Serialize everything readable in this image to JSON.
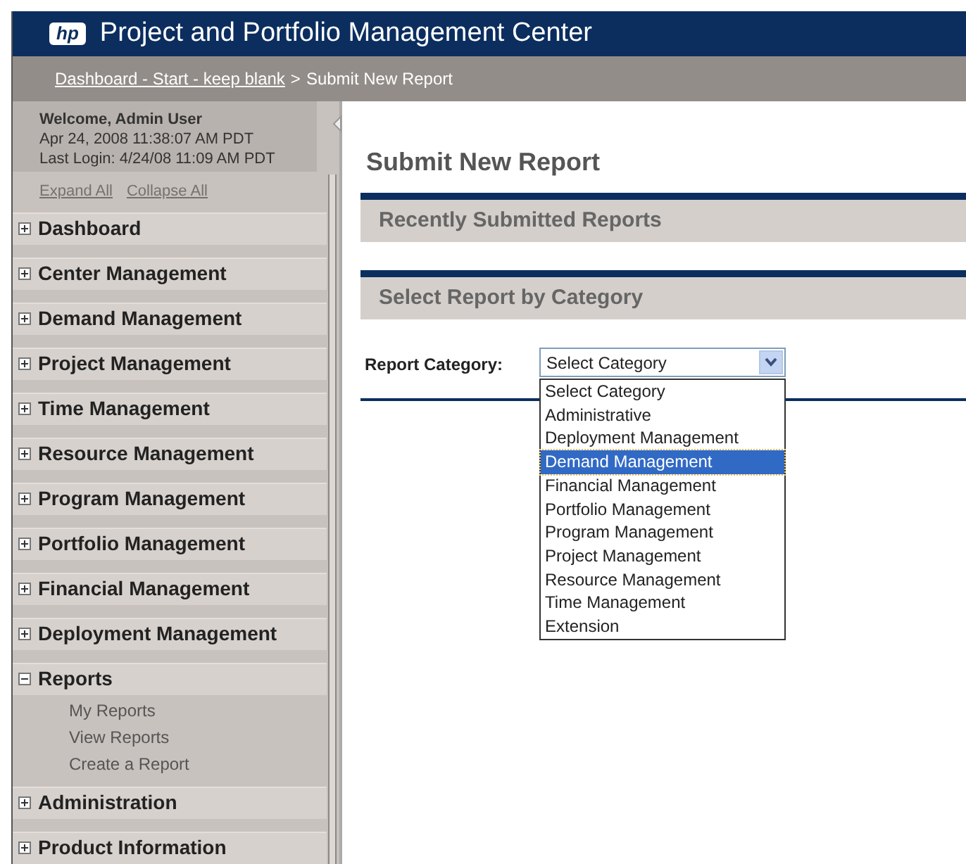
{
  "header": {
    "logo_text": "hp",
    "title": "Project and Portfolio Management Center"
  },
  "breadcrumb": {
    "link": "Dashboard - Start - keep blank",
    "separator": ">",
    "current": "Submit New Report"
  },
  "sidebar": {
    "welcome": "Welcome, Admin User",
    "datetime": "Apr 24, 2008 11:38:07 AM PDT",
    "last_login": "Last Login: 4/24/08 11:09 AM PDT",
    "expand_all": "Expand All",
    "collapse_all": "Collapse All",
    "items": [
      {
        "label": "Dashboard",
        "expanded": false
      },
      {
        "label": "Center Management",
        "expanded": false
      },
      {
        "label": "Demand Management",
        "expanded": false
      },
      {
        "label": "Project Management",
        "expanded": false
      },
      {
        "label": "Time Management",
        "expanded": false
      },
      {
        "label": "Resource Management",
        "expanded": false
      },
      {
        "label": "Program Management",
        "expanded": false
      },
      {
        "label": "Portfolio Management",
        "expanded": false
      },
      {
        "label": "Financial Management",
        "expanded": false
      },
      {
        "label": "Deployment Management",
        "expanded": false
      },
      {
        "label": "Reports",
        "expanded": true,
        "children": [
          {
            "label": "My Reports"
          },
          {
            "label": "View Reports"
          },
          {
            "label": "Create a Report"
          }
        ]
      },
      {
        "label": "Administration",
        "expanded": false
      },
      {
        "label": "Product Information",
        "expanded": false
      }
    ]
  },
  "page_title": "Submit New Report",
  "sections": [
    {
      "title": "Recently Submitted Reports"
    },
    {
      "title": "Select Report by Category"
    }
  ],
  "category_field": {
    "label": "Report Category:",
    "value": "Select Category",
    "expanded": true,
    "options": [
      {
        "label": "Select Category",
        "highlighted": false
      },
      {
        "label": "Administrative",
        "highlighted": false
      },
      {
        "label": "Deployment Management",
        "highlighted": false
      },
      {
        "label": "Demand Management",
        "highlighted": true
      },
      {
        "label": "Financial Management",
        "highlighted": false
      },
      {
        "label": "Portfolio Management",
        "highlighted": false
      },
      {
        "label": "Program Management",
        "highlighted": false
      },
      {
        "label": "Project Management",
        "highlighted": false
      },
      {
        "label": "Resource Management",
        "highlighted": false
      },
      {
        "label": "Time Management",
        "highlighted": false
      },
      {
        "label": "Extension",
        "highlighted": false
      }
    ]
  }
}
